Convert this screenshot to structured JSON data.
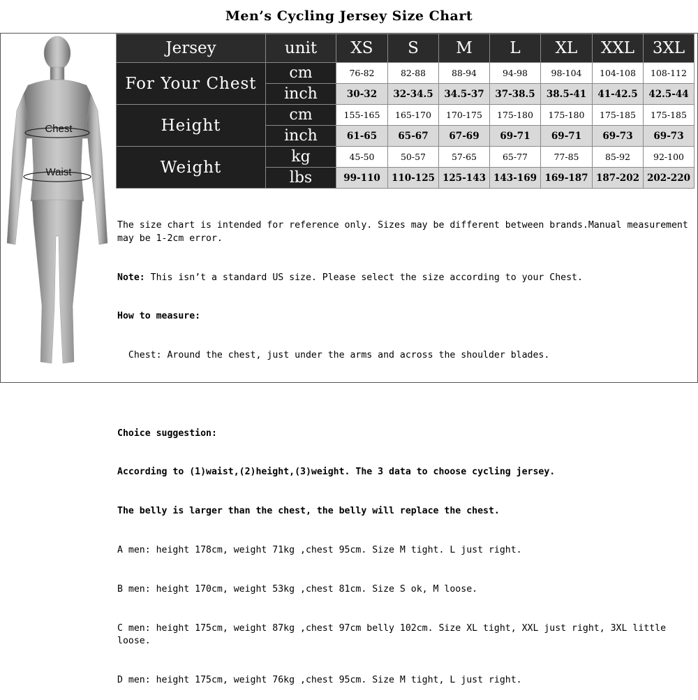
{
  "title": "Men’s Cycling Jersey Size Chart",
  "figure": {
    "chest_label": "Chest",
    "waist_label": "Waist"
  },
  "header": {
    "col0": "Jersey",
    "col1": "unit",
    "sizes": [
      "XS",
      "S",
      "M",
      "L",
      "XL",
      "XXL",
      "3XL"
    ]
  },
  "rows": {
    "chest": {
      "label": "For Your Chest",
      "cm": {
        "unit": "cm",
        "values": [
          "76-82",
          "82-88",
          "88-94",
          "94-98",
          "98-104",
          "104-108",
          "108-112"
        ]
      },
      "inch": {
        "unit": "inch",
        "values": [
          "30-32",
          "32-34.5",
          "34.5-37",
          "37-38.5",
          "38.5-41",
          "41-42.5",
          "42.5-44"
        ]
      }
    },
    "height": {
      "label": "Height",
      "cm": {
        "unit": "cm",
        "values": [
          "155-165",
          "165-170",
          "170-175",
          "175-180",
          "175-180",
          "175-185",
          "175-185"
        ]
      },
      "inch": {
        "unit": "inch",
        "values": [
          "61-65",
          "65-67",
          "67-69",
          "69-71",
          "69-71",
          "69-73",
          "69-73"
        ]
      }
    },
    "weight": {
      "label": "Weight",
      "kg": {
        "unit": "kg",
        "values": [
          "45-50",
          "50-57",
          "57-65",
          "65-77",
          "77-85",
          "85-92",
          "92-100"
        ]
      },
      "lbs": {
        "unit": "lbs",
        "values": [
          "99-110",
          "110-125",
          "125-143",
          "143-169",
          "169-187",
          "187-202",
          "202-220"
        ]
      }
    }
  },
  "notes": {
    "disclaimer": "The size chart is intended for reference only. Sizes may be different between brands.Manual measurement may be 1-2cm error.",
    "note_label": "Note:",
    "note_text": " This isn’t a standard US size. Please select the size according to your Chest.",
    "how_label": "How to measure:",
    "how_text": "  Chest: Around the chest, just under the arms and across the shoulder blades.",
    "choice_label": "Choice suggestion:",
    "choice_line1": "According to (1)waist,(2)height,(3)weight. The 3 data to choose cycling jersey.",
    "choice_line2": "The belly is larger than the chest, the belly will replace the chest.",
    "examples": [
      "A men: height 178cm, weight 71kg ,chest 95cm. Size M tight. L just right.",
      "B men: height 170cm, weight 53kg ,chest 81cm. Size S ok, M loose.",
      "C men: height 175cm, weight 87kg ,chest 97cm belly 102cm. Size XL tight, XXL just right, 3XL little loose.",
      "D men: height 175cm, weight 76kg ,chest 95cm. Size M tight, L just right."
    ]
  }
}
